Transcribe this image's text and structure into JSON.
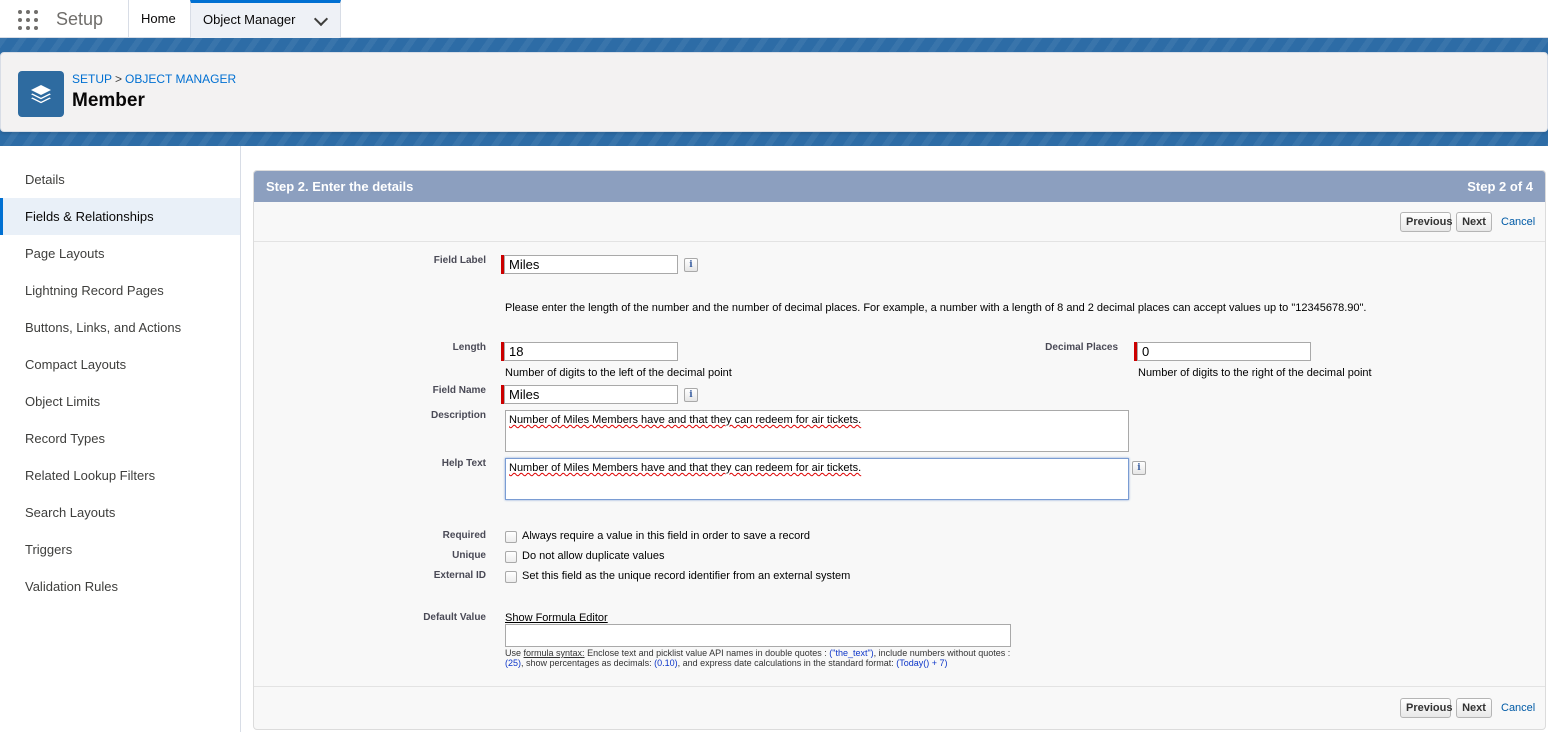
{
  "topnav": {
    "app_name": "Setup",
    "tabs": [
      {
        "label": "Home"
      },
      {
        "label": "Object Manager"
      }
    ]
  },
  "header": {
    "breadcrumb": [
      "SETUP",
      ">",
      "OBJECT MANAGER"
    ],
    "title": "Member",
    "icon": "stacked-layers-icon"
  },
  "sidebar": {
    "items": [
      {
        "label": "Details"
      },
      {
        "label": "Fields & Relationships",
        "active": true
      },
      {
        "label": "Page Layouts"
      },
      {
        "label": "Lightning Record Pages"
      },
      {
        "label": "Buttons, Links, and Actions"
      },
      {
        "label": "Compact Layouts"
      },
      {
        "label": "Object Limits"
      },
      {
        "label": "Record Types"
      },
      {
        "label": "Related Lookup Filters"
      },
      {
        "label": "Search Layouts"
      },
      {
        "label": "Triggers"
      },
      {
        "label": "Validation Rules"
      }
    ]
  },
  "wizard": {
    "title": "Step 2. Enter the details",
    "step": "Step 2 of 4",
    "buttons": {
      "previous": "Previous",
      "next": "Next",
      "cancel": "Cancel"
    },
    "field_label": {
      "label": "Field Label",
      "value": "Miles"
    },
    "length_note": "Please enter the length of the number and the number of decimal places. For example, a number with a length of 8 and 2 decimal places can accept values up to \"12345678.90\".",
    "length": {
      "label": "Length",
      "value": "18",
      "hint": "Number of digits to the left of the decimal point"
    },
    "decimal_places": {
      "label": "Decimal Places",
      "value": "0",
      "hint": "Number of digits to the right of the decimal point"
    },
    "field_name": {
      "label": "Field Name",
      "value": "Miles"
    },
    "description": {
      "label": "Description",
      "value": "Number of Miles Members have and that they can redeem for air tickets."
    },
    "help_text": {
      "label": "Help Text",
      "value": "Number of Miles Members have and that they can redeem for air tickets."
    },
    "required": {
      "label": "Required",
      "option": "Always require a value in this field in order to save a record"
    },
    "unique": {
      "label": "Unique",
      "option": "Do not allow duplicate values"
    },
    "external_id": {
      "label": "External ID",
      "option": "Set this field as the unique record identifier from an external system"
    },
    "default_value": {
      "label": "Default Value",
      "formula_link": "Show Formula Editor",
      "help_use": "Use",
      "help_syntax": "formula syntax:",
      "help_1": "Enclose text and picklist value API names in double quotes :",
      "help_ex1": "(\"the_text\")",
      "help_2": ", include numbers without quotes :",
      "help_ex2": "(25)",
      "help_3": ", show percentages as decimals:",
      "help_ex3": "(0.10)",
      "help_4": ", and express date calculations in the standard format:",
      "help_ex4": "(Today() + 7)"
    }
  },
  "colors": {
    "brand_band": "#2d6ca6",
    "step_header": "#8c9fbf",
    "link": "#0070d2",
    "required": "#cc0000"
  }
}
